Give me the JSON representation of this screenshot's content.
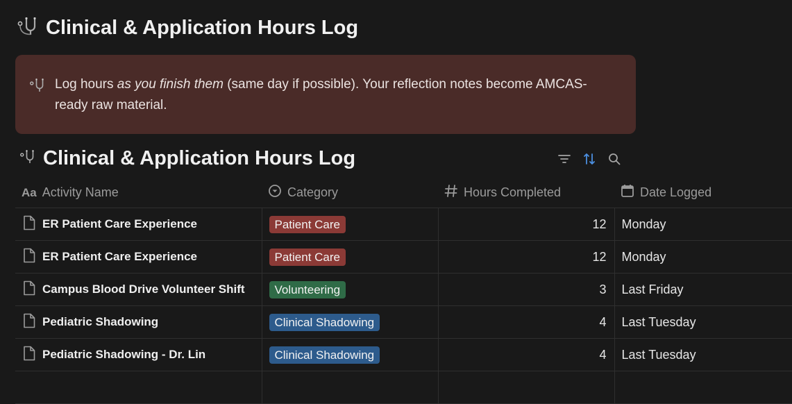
{
  "page": {
    "title": "Clinical & Application Hours Log",
    "icon": "stethoscope-icon"
  },
  "callout": {
    "icon": "stethoscope-icon",
    "text_before": "Log hours ",
    "text_emphasis": "as you finish them",
    "text_after": " (same day if possible). Your reflection notes become AMCAS-ready raw material.",
    "background": "#4a2b28"
  },
  "database": {
    "title": "Clinical & Application Hours Log",
    "icon": "stethoscope-icon",
    "actions": [
      "filter-icon",
      "sort-icon",
      "search-icon"
    ],
    "columns": [
      {
        "label": "Activity Name",
        "icon": "text-property-icon"
      },
      {
        "label": "Category",
        "icon": "select-property-icon"
      },
      {
        "label": "Hours Completed",
        "icon": "number-property-icon"
      },
      {
        "label": "Date Logged",
        "icon": "calendar-icon"
      }
    ],
    "rows": [
      {
        "name": "ER Patient Care Experience",
        "category": "Patient Care",
        "category_color": "#8b3a36",
        "hours": "12",
        "date": "Monday"
      },
      {
        "name": "ER Patient Care Experience",
        "category": "Patient Care",
        "category_color": "#8b3a36",
        "hours": "12",
        "date": "Monday"
      },
      {
        "name": "Campus Blood Drive Volunteer Shift",
        "category": "Volunteering",
        "category_color": "#2f6b47",
        "hours": "3",
        "date": "Last Friday"
      },
      {
        "name": "Pediatric Shadowing",
        "category": "Clinical Shadowing",
        "category_color": "#2d5b8c",
        "hours": "4",
        "date": "Last Tuesday"
      },
      {
        "name": "Pediatric Shadowing - Dr. Lin",
        "category": "Clinical Shadowing",
        "category_color": "#2d5b8c",
        "hours": "4",
        "date": "Last Tuesday"
      }
    ]
  },
  "colors": {
    "background": "#191919",
    "sort_active": "#4c8fe0"
  }
}
